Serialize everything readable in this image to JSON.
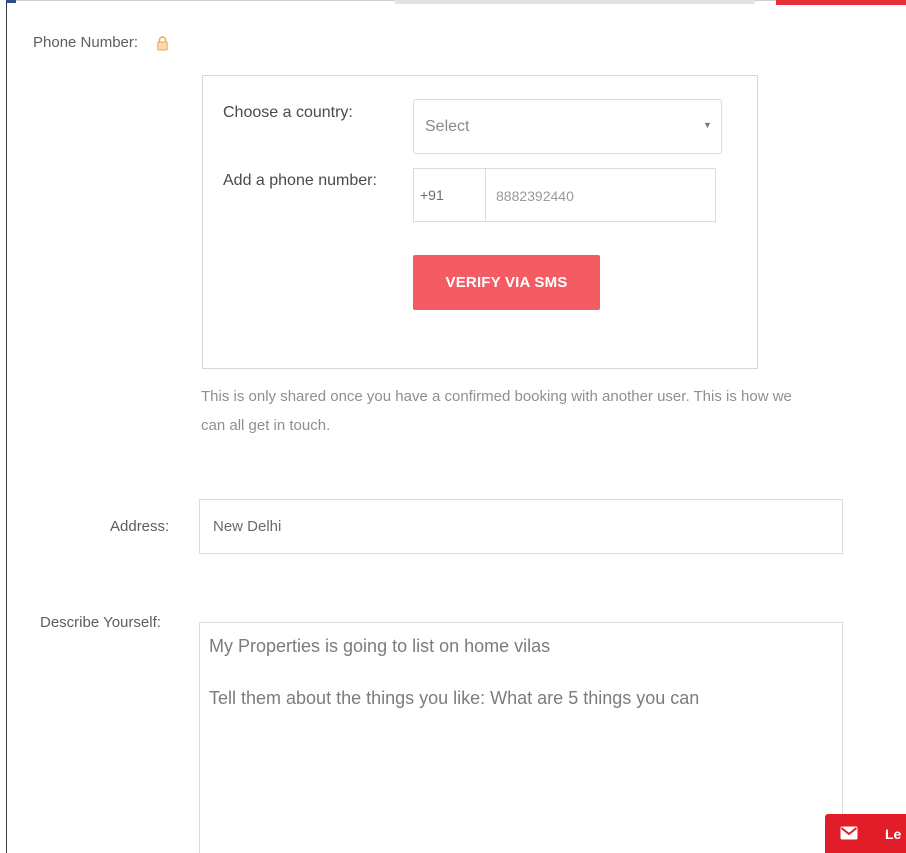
{
  "phone_section": {
    "label": "Phone Number:",
    "country_label": "Choose a country:",
    "country_select_value": "Select",
    "phone_label": "Add a phone number:",
    "country_code": "+91",
    "phone_value": "8882392440",
    "verify_button": "VERIFY VIA SMS",
    "help_line1": "This is only shared once you have a confirmed booking with another user. This is how we",
    "help_line2": "can all get in touch."
  },
  "address": {
    "label": "Address:",
    "value": "New Delhi"
  },
  "describe": {
    "label": "Describe Yourself:",
    "line1": "My Properties is going to list on home vilas",
    "line2": "Tell them about the things you like: What are 5 things you can"
  },
  "chat_widget": {
    "label": "Le"
  },
  "colors": {
    "accent": "#f45b63",
    "chat_red": "#e11d2a",
    "lock_icon": "#f2a34a"
  },
  "icons": {
    "lock": "lock-icon",
    "caret": "chevron-down-icon",
    "mail": "mail-icon"
  }
}
